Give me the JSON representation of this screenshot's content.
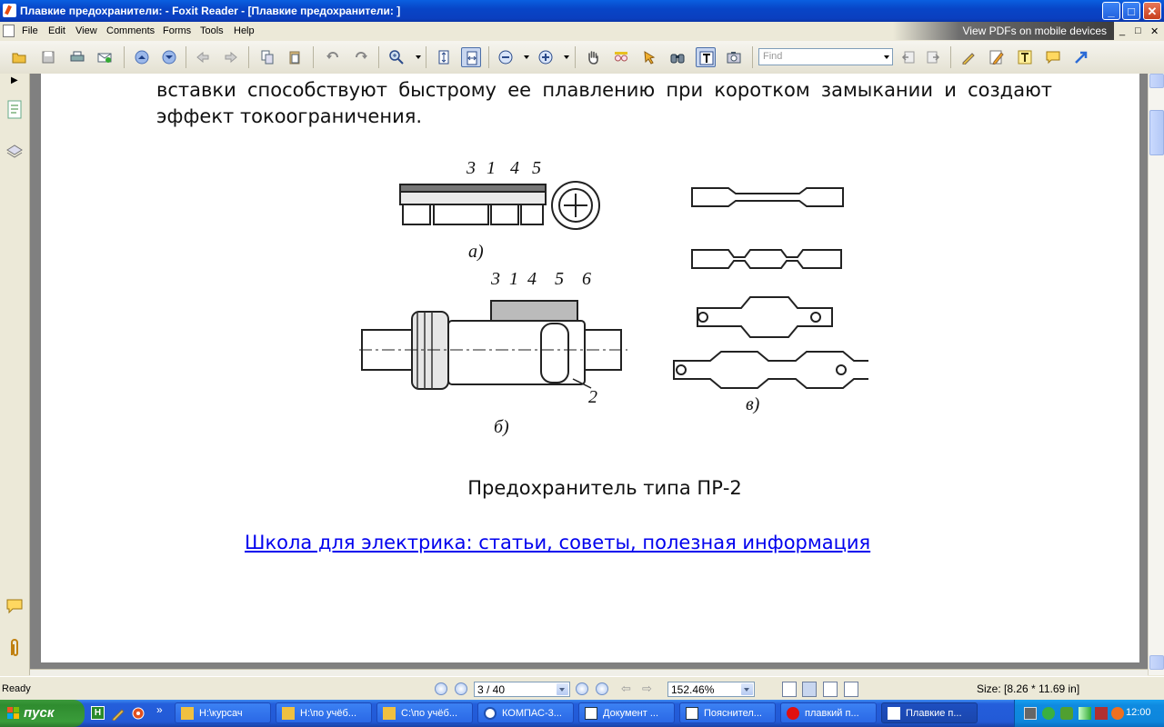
{
  "window": {
    "title": "Плавкие предохранители:  - Foxit Reader - [Плавкие предохранители: ]",
    "controls": {
      "minimize": "_",
      "maximize": "□",
      "close": "✕"
    }
  },
  "menubar": {
    "items": [
      "File",
      "Edit",
      "View",
      "Comments",
      "Forms",
      "Tools",
      "Help"
    ],
    "banner": "View PDFs on mobile devices",
    "mdi_controls": [
      "_",
      "□",
      "✕"
    ]
  },
  "toolbar": {
    "find_placeholder": "Find"
  },
  "document": {
    "body_text": "вставки способствуют быстрому ее плавлению при коротком замыкании и создают эффект токоограничения.",
    "figure_labels": {
      "top_numbers": [
        "3",
        "1",
        "4",
        "5"
      ],
      "bottom_numbers": [
        "3",
        "1",
        "4",
        "5",
        "6"
      ],
      "label_2": "2",
      "a": "а)",
      "b": "б)",
      "v": "в)"
    },
    "caption": "Предохранитель типа ПР-2",
    "link": "Школа для электрика: статьи, советы, полезная информация "
  },
  "statusbar": {
    "ready": "Ready",
    "page": "3 / 40",
    "zoom": "152.46%",
    "size": "Size: [8.26 * 11.69 in]"
  },
  "taskbar": {
    "start_label": "пуск",
    "tasks": [
      "H:\\курсач",
      "H:\\по учёб...",
      "C:\\по учёб...",
      "КОМПАС-3...",
      "Документ ...",
      "Пояснител...",
      "плавкий п...",
      "Плавкие п..."
    ],
    "clock": "12:00"
  },
  "colors": {
    "titlebar": "#0845c7",
    "taskbar": "#245edb",
    "start": "#3a9c3a",
    "link": "#0000ee"
  }
}
